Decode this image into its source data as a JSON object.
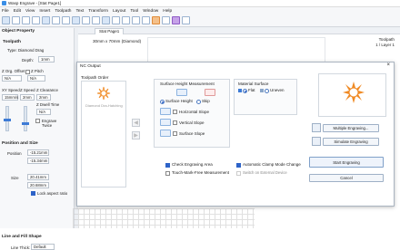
{
  "window": {
    "title": "Wasp Engrave - [Stat Page1]"
  },
  "menu": [
    "File",
    "Edit",
    "View",
    "Insert",
    "Toolpath",
    "Text",
    "Transform",
    "Layout",
    "Tool",
    "Window",
    "Help"
  ],
  "left_panel": {
    "object_property_label": "Object Property",
    "toolpath_label": "Toolpath",
    "type_label": "Type: Diamond Drag",
    "depth_label": "Depth:",
    "depth_value": "1mm",
    "z_org_offset_label": "Z Org. Offset",
    "z_org_value": "N/A",
    "z_pitch_label": "Z Pitch",
    "z_pitch_value": "N/A",
    "xy_speed_label": "XY Speed",
    "xy_speed_value": "15mm/s",
    "z_speed_label": "Z Speed",
    "z_speed_value": "2mm",
    "z_clearance_label": "Z Clearance",
    "z_clearance_value": "2mm",
    "z_dwell_label": "Z Dwell Time",
    "z_dwell_value": "N/A",
    "engrave_twice_label": "Engrave Twice",
    "position_size_label": "Position and Size",
    "position_label": "Position",
    "pos_x_value": "-15.21mm",
    "pos_y_value": "-15.34mm",
    "size_label": "Size",
    "size_x_value": "20.41mm",
    "size_y_value": "20.68mm",
    "lock_aspect_label": "Lock aspect ratio",
    "line_fill_label": "Line and Fill Shape",
    "line_type_label": "Line Thick:",
    "line_type_value": "Default"
  },
  "doc": {
    "tab_label": "Stat Page1",
    "size_text": "30mm x 70mm (Diamond)",
    "toolpath_text": "Toolpath",
    "layer_text": "1 / Layer 1"
  },
  "dialog": {
    "title": "NC Output",
    "toolpath_order_label": "Toolpath Order",
    "toolpath_item": "Diamond Dra-Hatching",
    "surface_height_label": "Surface Height Measurement",
    "surface_height_option": "Surface Height",
    "skip_option": "Skip",
    "horizontal_slope": "Horizontal Slope",
    "vertical_slope": "Vertical Slope",
    "surface_slope": "Surface Slope",
    "material_surface_label": "Material Surface",
    "flat_option": "Flat",
    "uneven_option": "Uneven",
    "check_engraving_area": "Check Engraving Area",
    "touch_mark_free": "Touch-Mark-Free Measurement",
    "auto_clamp": "Automatic Clamp Mode Change",
    "switch_external": "Switch on External Device",
    "multiple_engraving_btn": "Multiple Engraving...",
    "simulate_engraving_btn": "Simulate Engraving",
    "start_engraving_btn": "Start Engraving",
    "cancel_btn": "Cancel"
  },
  "colors": {
    "accent": "#2d63c8",
    "flower": "#f08a24",
    "dialog_border": "#aab4c0"
  }
}
